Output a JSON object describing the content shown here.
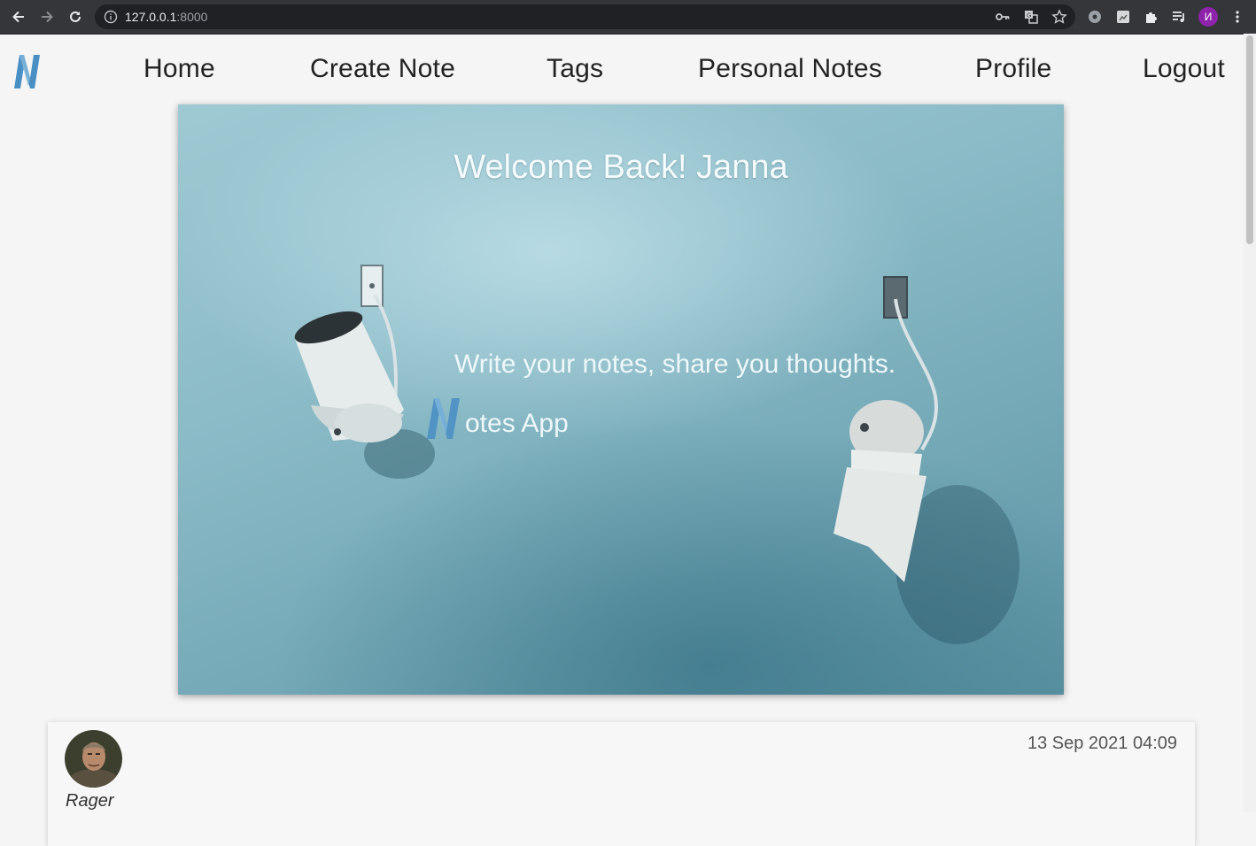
{
  "browser": {
    "url_host": "127.0.0.1",
    "url_port": ":8000",
    "profile_initial": "И"
  },
  "nav": {
    "home": "Home",
    "create_note": "Create Note",
    "tags": "Tags",
    "personal_notes": "Personal Notes",
    "profile": "Profile",
    "logout": "Logout"
  },
  "hero": {
    "welcome": "Welcome Back! Janna",
    "tagline": "Write your notes, share you thoughts.",
    "brand": "otes App"
  },
  "note": {
    "author": "Rager",
    "date": "13 Sep 2021 04:09"
  },
  "colors": {
    "brand_blue": "#4a8fc4",
    "chrome_bg": "#35363a",
    "omnibox_bg": "#202124"
  }
}
